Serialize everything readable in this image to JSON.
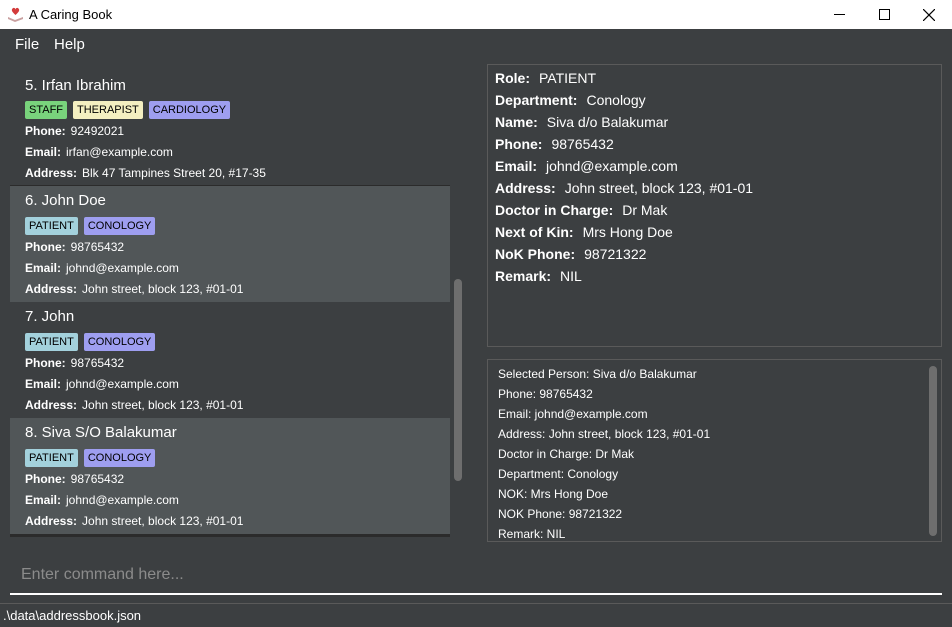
{
  "window": {
    "title": "A Caring Book"
  },
  "menu": {
    "file": "File",
    "help": "Help"
  },
  "persons": [
    {
      "index_name": "5. Irfan Ibrahim",
      "tags": [
        {
          "label": "STAFF",
          "type": "staff"
        },
        {
          "label": "THERAPIST",
          "type": "therapist"
        },
        {
          "label": "CARDIOLOGY",
          "type": "cardiology"
        }
      ],
      "phone_label": "Phone:",
      "phone": "92492021",
      "email_label": "Email:",
      "email": "irfan@example.com",
      "address_label": "Address:",
      "address": "Blk 47 Tampines Street 20, #17-35"
    },
    {
      "index_name": "6. John Doe",
      "tags": [
        {
          "label": "PATIENT",
          "type": "patient"
        },
        {
          "label": "CONOLOGY",
          "type": "conology"
        }
      ],
      "phone_label": "Phone:",
      "phone": "98765432",
      "email_label": "Email:",
      "email": "johnd@example.com",
      "address_label": "Address:",
      "address": "John street, block 123, #01-01"
    },
    {
      "index_name": "7. John",
      "tags": [
        {
          "label": "PATIENT",
          "type": "patient"
        },
        {
          "label": "CONOLOGY",
          "type": "conology"
        }
      ],
      "phone_label": "Phone:",
      "phone": "98765432",
      "email_label": "Email:",
      "email": "johnd@example.com",
      "address_label": "Address:",
      "address": "John street, block 123, #01-01"
    },
    {
      "index_name": "8. Siva S/O Balakumar",
      "tags": [
        {
          "label": "PATIENT",
          "type": "patient"
        },
        {
          "label": "CONOLOGY",
          "type": "conology"
        }
      ],
      "phone_label": "Phone:",
      "phone": "98765432",
      "email_label": "Email:",
      "email": "johnd@example.com",
      "address_label": "Address:",
      "address": "John street, block 123, #01-01"
    }
  ],
  "detail": {
    "rows": [
      {
        "label": "Role:",
        "value": "PATIENT"
      },
      {
        "label": "Department:",
        "value": "Conology"
      },
      {
        "label": "Name:",
        "value": "Siva d/o Balakumar"
      },
      {
        "label": "Phone:",
        "value": "98765432"
      },
      {
        "label": "Email:",
        "value": "johnd@example.com"
      },
      {
        "label": "Address:",
        "value": "John street, block 123, #01-01"
      },
      {
        "label": "Doctor in Charge:",
        "value": "Dr Mak"
      },
      {
        "label": "Next of Kin:",
        "value": "Mrs Hong Doe"
      },
      {
        "label": "NoK Phone:",
        "value": "98721322"
      },
      {
        "label": "Remark:",
        "value": "NIL"
      }
    ]
  },
  "result": {
    "lines": [
      "Selected Person: Siva d/o Balakumar",
      "Phone: 98765432",
      "Email: johnd@example.com",
      "Address: John street, block 123, #01-01",
      "Doctor in Charge: Dr Mak",
      "Department: Conology",
      "NOK: Mrs Hong Doe",
      "NOK Phone: 98721322",
      "Remark: NIL"
    ]
  },
  "command": {
    "placeholder": "Enter command here...",
    "value": ""
  },
  "status": {
    "path": ".\\data\\addressbook.json"
  },
  "colors": {
    "background": "#3c3f41",
    "card_alt": "#515658",
    "tag_staff": "#79d37c",
    "tag_therapist": "#f4efc1",
    "tag_purple": "#9e9ef0",
    "tag_patient": "#a3d1dc"
  }
}
